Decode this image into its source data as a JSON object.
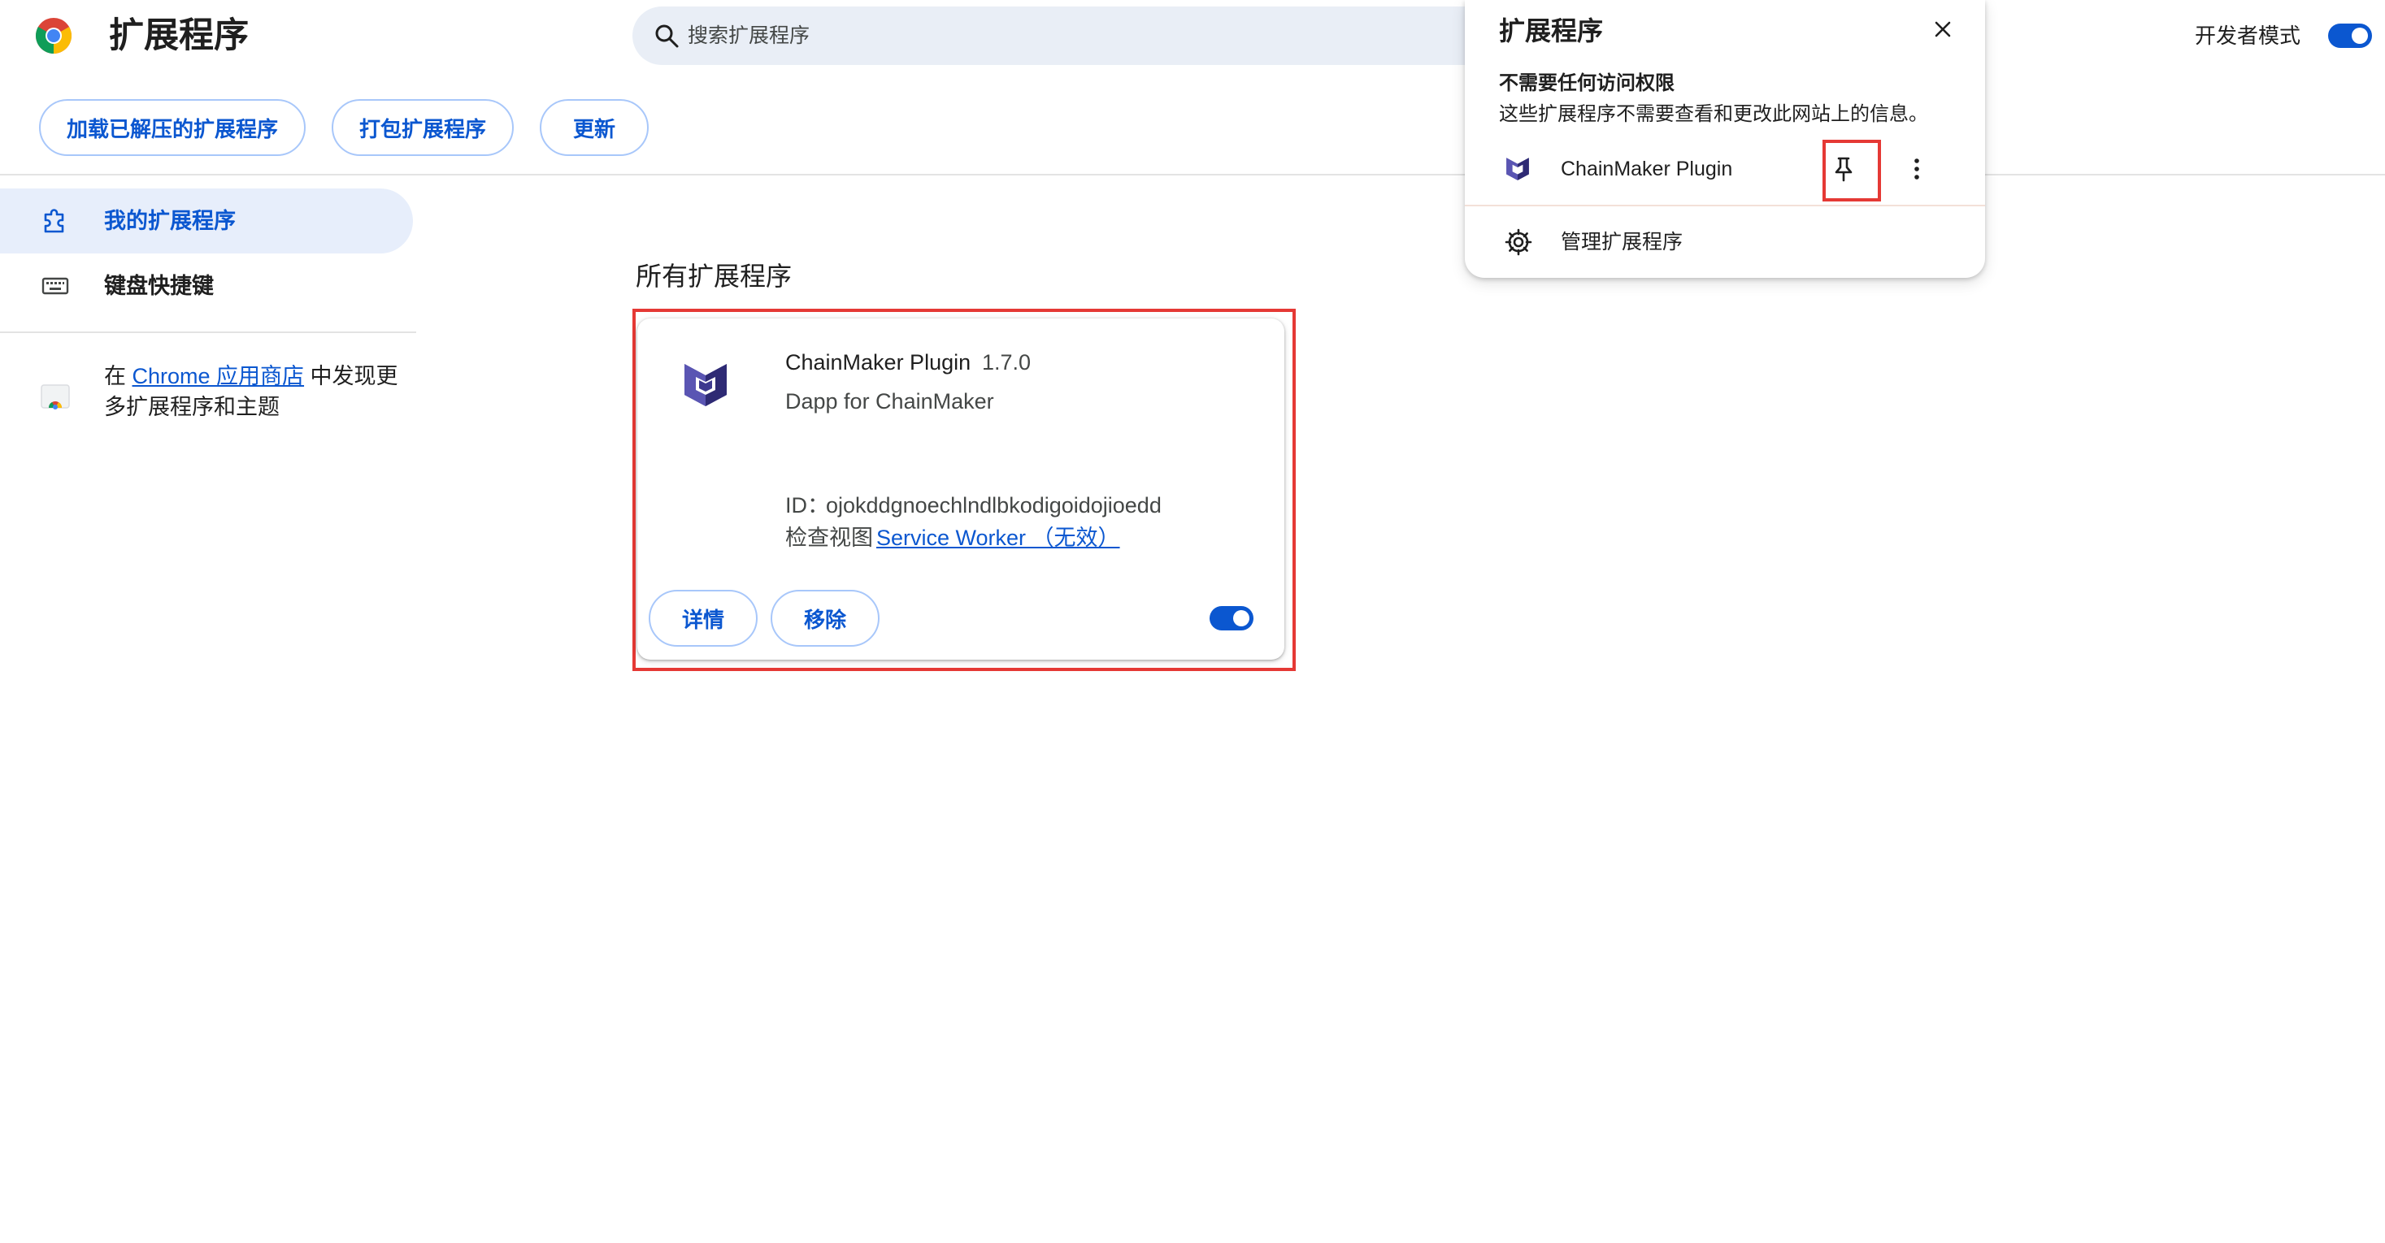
{
  "header": {
    "title": "扩展程序",
    "search_placeholder": "搜索扩展程序",
    "dev_mode_label": "开发者模式",
    "dev_mode_on": true
  },
  "toolbar": {
    "load_unpacked_label": "加载已解压的扩展程序",
    "pack_label": "打包扩展程序",
    "update_label": "更新"
  },
  "sidebar": {
    "items": [
      {
        "label": "我的扩展程序",
        "icon": "puzzle-icon",
        "active": true
      },
      {
        "label": "键盘快捷键",
        "icon": "keyboard-icon",
        "active": false
      }
    ],
    "store_prefix": "在 ",
    "store_link": "Chrome 应用商店",
    "store_suffix": " 中发现更多扩展程序和主题"
  },
  "main": {
    "section_title": "所有扩展程序",
    "extensions": [
      {
        "name": "ChainMaker Plugin",
        "version": "1.7.0",
        "description": "Dapp for ChainMaker",
        "id_label": "ID：",
        "id": "ojokddgnoechlndlbkodigoidojioedd",
        "inspect_label": "检查视图",
        "service_worker_link": "Service Worker （无效）",
        "details_label": "详情",
        "remove_label": "移除",
        "enabled": true
      }
    ]
  },
  "popup": {
    "title": "扩展程序",
    "subtitle": "不需要任何访问权限",
    "description": "这些扩展程序不需要查看和更改此网站上的信息。",
    "extension_name": "ChainMaker Plugin",
    "manage_label": "管理扩展程序"
  },
  "colors": {
    "accent": "#0b57d0",
    "highlight": "#e53935",
    "sidebar_active_bg": "#e7eefb",
    "search_bg": "#e9eef6"
  }
}
